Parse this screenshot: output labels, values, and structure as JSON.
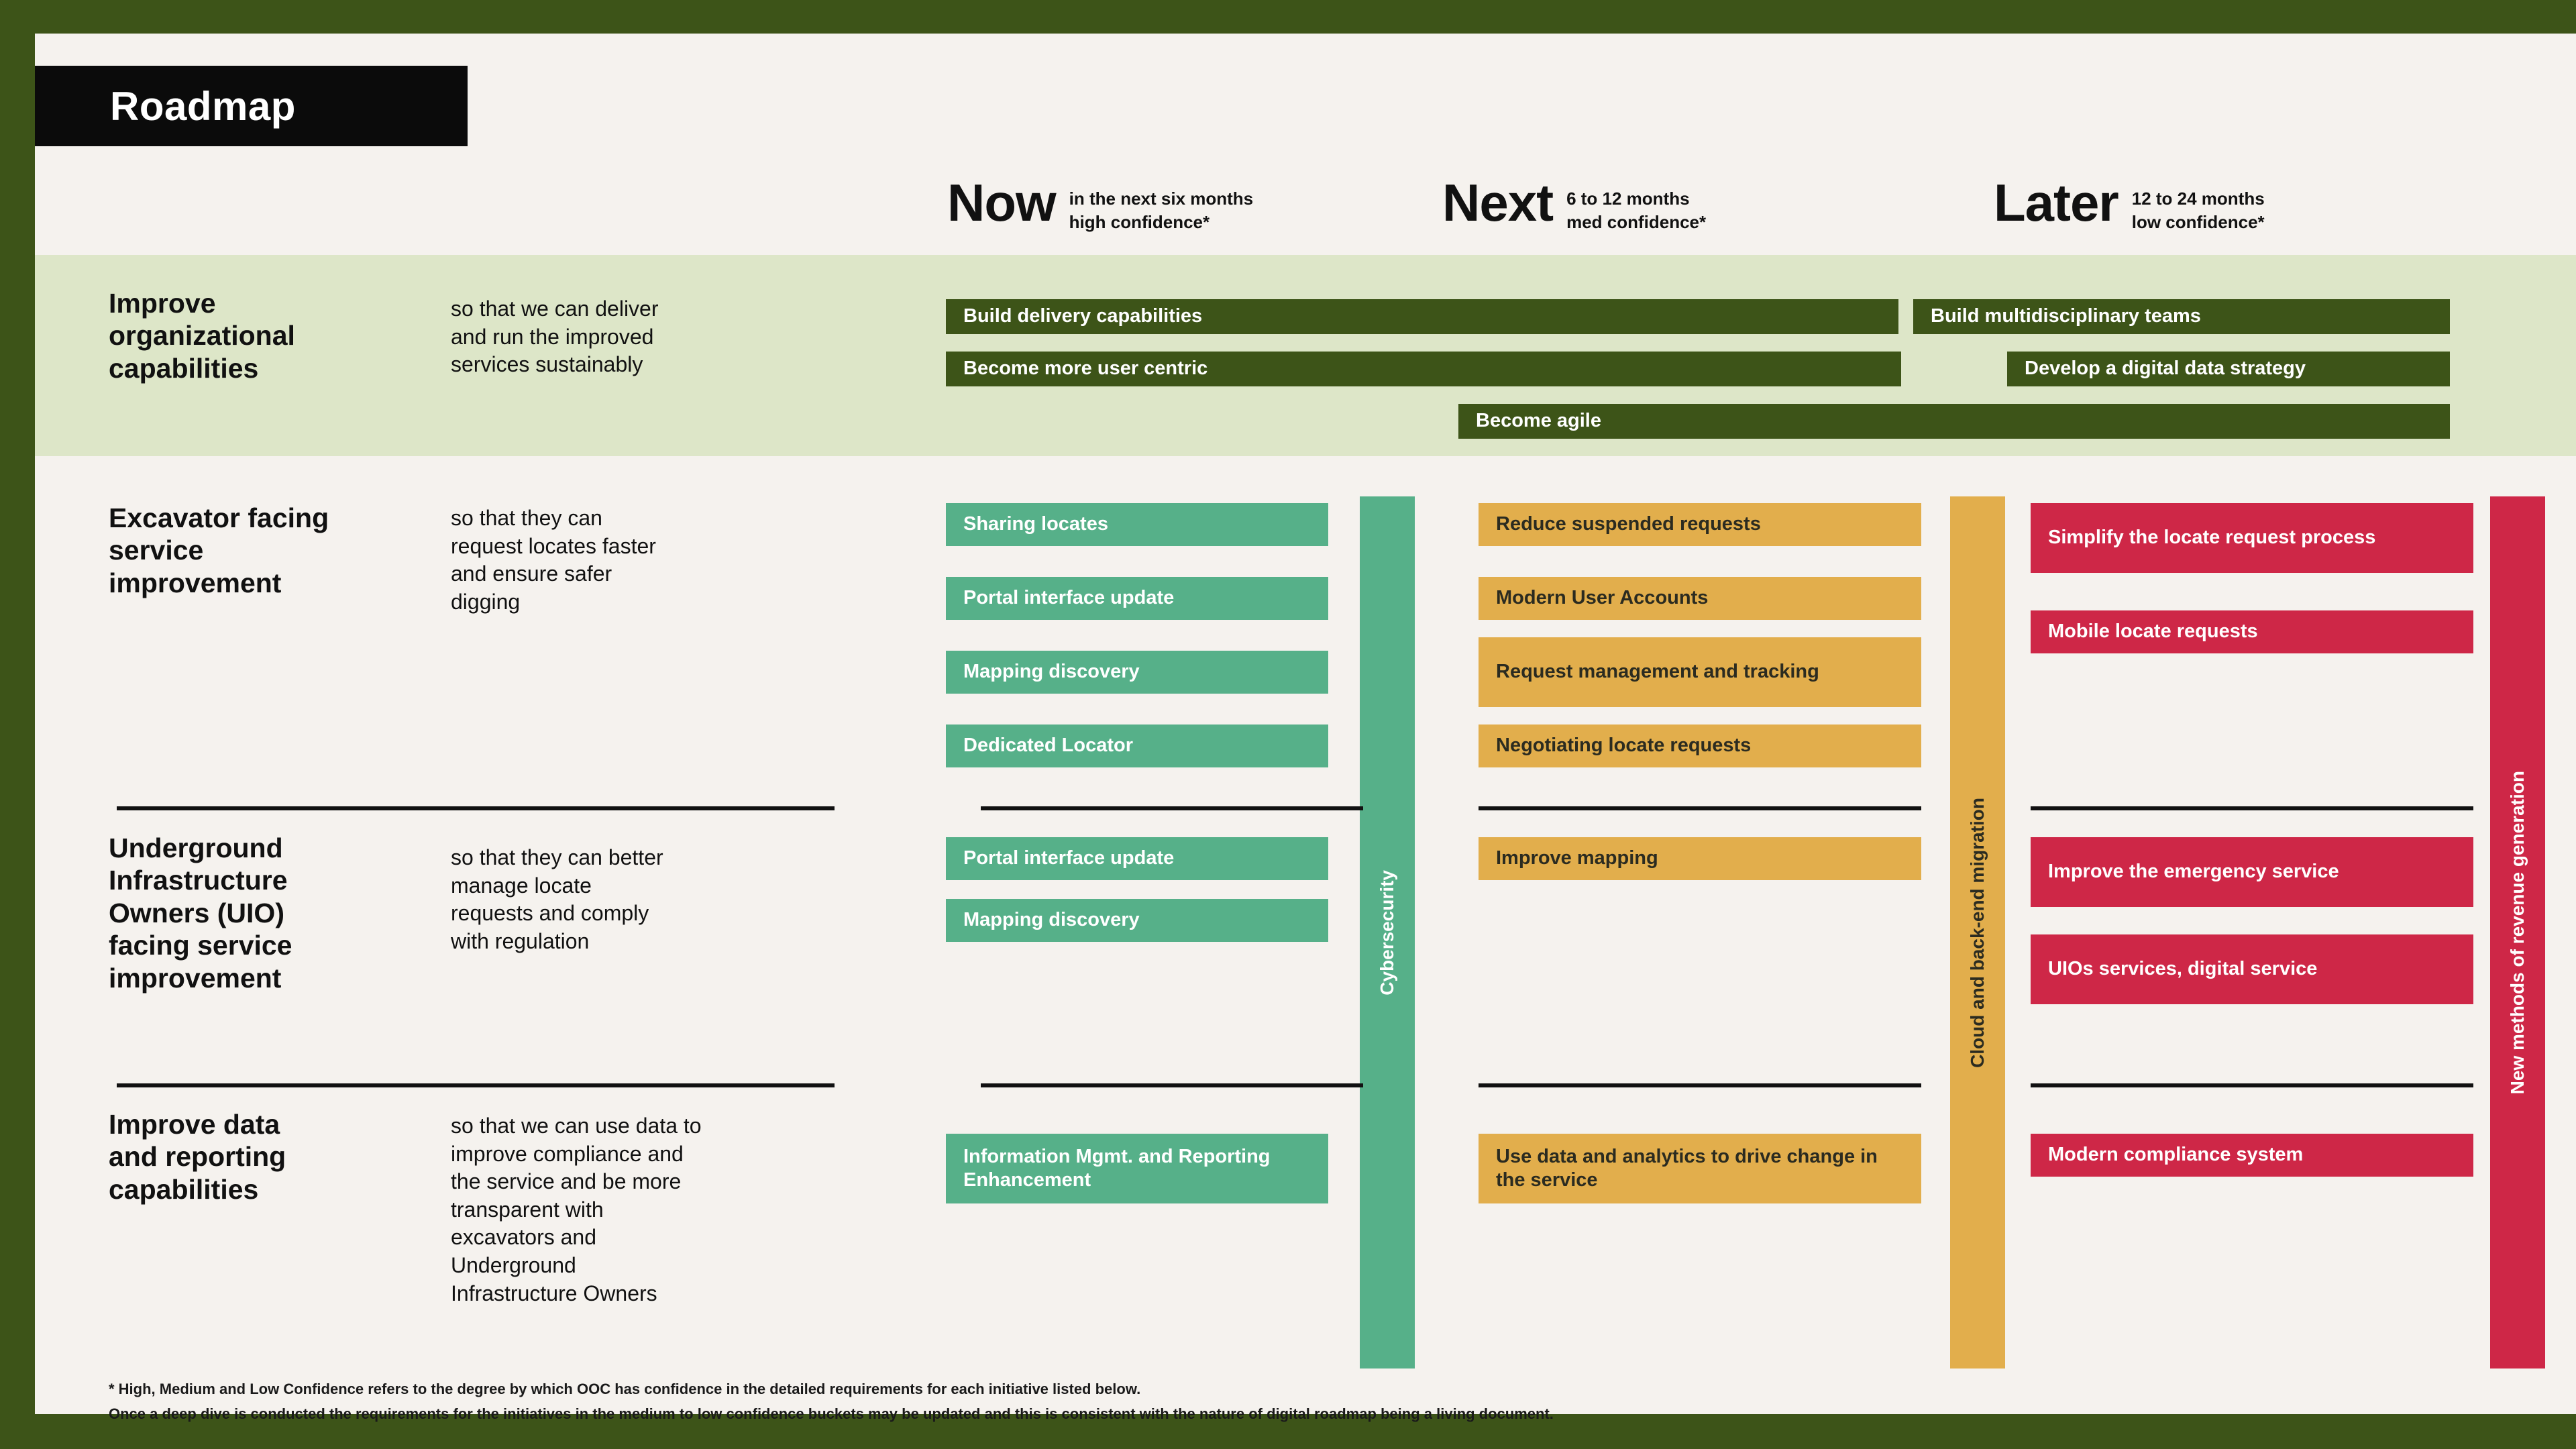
{
  "title": "Roadmap",
  "colors": {
    "page_border": "#3d5418",
    "canvas": "#f5f2ee",
    "band": "#dde6c8",
    "now": "#56b089",
    "next": "#e2ae4c",
    "later": "#ce2747",
    "dark_green": "#3d5418",
    "title_block": "#0b0b0b"
  },
  "columns": [
    {
      "name": "Now",
      "timeframe": "in the next six months",
      "confidence": "high confidence*"
    },
    {
      "name": "Next",
      "timeframe": "6 to 12 months",
      "confidence": "med confidence*"
    },
    {
      "name": "Later",
      "timeframe": "12 to 24  months",
      "confidence": "low confidence*"
    }
  ],
  "rows": [
    {
      "label": "Improve\norganizational\ncapabilities",
      "description": "so that we can deliver\nand run the improved\nservices sustainably",
      "items": [
        {
          "text": "Build delivery capabilities",
          "style": "dark"
        },
        {
          "text": "Build multidisciplinary teams",
          "style": "dark"
        },
        {
          "text": "Become more user centric",
          "style": "dark"
        },
        {
          "text": "Develop a digital data strategy",
          "style": "dark"
        },
        {
          "text": "Become agile",
          "style": "dark"
        }
      ]
    },
    {
      "label": "Excavator facing\nservice\nimprovement",
      "description": "so that they can\nrequest locates faster\nand ensure safer\ndigging",
      "now": [
        "Sharing locates",
        "Portal interface update",
        "Mapping discovery",
        "Dedicated Locator"
      ],
      "next": [
        "Reduce suspended requests",
        "Modern User Accounts",
        "Request management and tracking",
        "Negotiating locate requests"
      ],
      "later": [
        "Simplify the locate request process",
        "Mobile locate requests"
      ]
    },
    {
      "label": "Underground\nInfrastructure\nOwners (UIO)\nfacing service\nimprovement",
      "description": "so that they can better\nmanage locate\nrequests and comply\nwith regulation",
      "now": [
        "Portal interface update",
        "Mapping discovery"
      ],
      "next": [
        "Improve mapping"
      ],
      "later": [
        "Improve the emergency service",
        "UIOs services, digital service"
      ]
    },
    {
      "label": "Improve data\nand reporting\ncapabilities",
      "description": "so that we can use data to\nimprove compliance and\nthe service and be more\ntransparent with\nexcavators and\nUnderground\nInfrastructure Owners",
      "now": [
        "Information Mgmt. and Reporting Enhancement"
      ],
      "next": [
        "Use data and analytics to drive change in the service"
      ],
      "later": [
        "Modern compliance system"
      ]
    }
  ],
  "theme_bars": [
    {
      "label": "Cybersecurity",
      "style": "green"
    },
    {
      "label": "Cloud and back-end migration",
      "style": "amber"
    },
    {
      "label": "New methods of revenue generation",
      "style": "red"
    }
  ],
  "footnotes": [
    "* High, Medium and Low Confidence refers to the degree by which OOC has confidence in the detailed requirements for each initiative listed below.",
    "Once a deep dive is conducted the requirements for the initiatives in the medium to low confidence buckets may be updated and this is consistent with the nature of digital roadmap being a living document."
  ]
}
